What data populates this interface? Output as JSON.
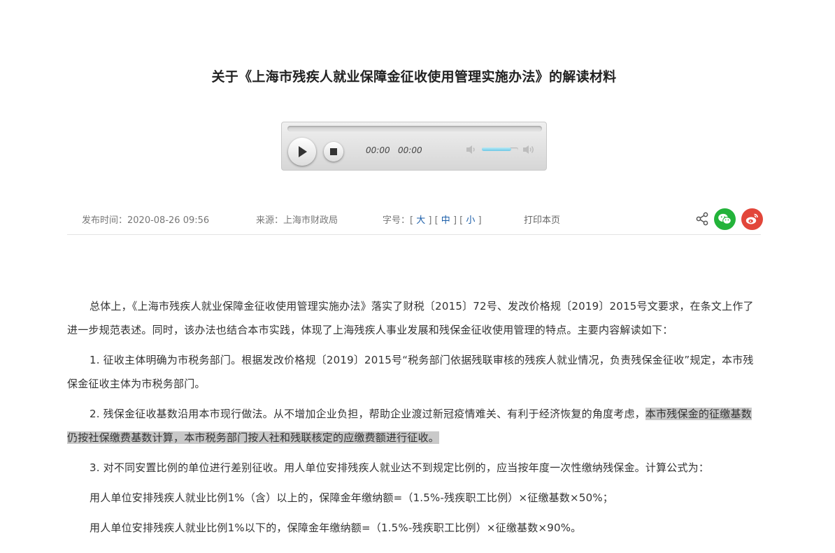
{
  "article": {
    "title": "关于《上海市残疾人就业保障金征收使用管理实施办法》的解读材料",
    "intro": "总体上，《上海市残疾人就业保障金征收使用管理实施办法》落实了财税〔2015〕72号、发改价格规〔2019〕2015号文要求，在条文上作了进一步规范表述。同时，该办法也结合本市实践，体现了上海残疾人事业发展和残保金征收使用管理的特点。主要内容解读如下：",
    "point1": "1. 征收主体明确为市税务部门。根据发改价格规〔2019〕2015号“税务部门依据残联审核的残疾人就业情况，负责残保金征收”规定，本市残保金征收主体为市税务部门。",
    "point2_plain": "2. 残保金征收基数沿用本市现行做法。从不增加企业负担，帮助企业渡过新冠疫情难关、有利于经济恢复的角度考虑，",
    "point2_highlight": "本市残保金的征缴基数仍按社保缴费基数计算，本市税务部门按人社和残联核定的应缴费额进行征收。",
    "point3": "3. 对不同安置比例的单位进行差别征收。用人单位安排残疾人就业达不到规定比例的，应当按年度一次性缴纳残保金。计算公式为：",
    "formula1": "用人单位安排残疾人就业比例1%（含）以上的，保障金年缴纳额=（1.5%-残疾职工比例）×征缴基数×50%；",
    "formula2": "用人单位安排残疾人就业比例1%以下的，保障金年缴纳额=（1.5%-残疾职工比例）×征缴基数×90%。"
  },
  "player": {
    "current_time": "00:00",
    "duration": "00:00",
    "progress": 0,
    "volume": 0.8,
    "play_icon": "play-icon",
    "stop_icon": "stop-icon",
    "volume_low_icon": "volume-low-icon",
    "volume_high_icon": "volume-high-icon"
  },
  "meta": {
    "publish_label": "发布时间：",
    "publish_date": "2020-08-26 09:56",
    "source_label": "来源：",
    "source": "上海市财政局",
    "font_label": "字号：",
    "font_large": "大",
    "font_medium": "中",
    "font_small": "小",
    "print": "打印本页"
  },
  "share": {
    "share_icon": "share-icon",
    "wechat_icon": "wechat-icon",
    "weibo_icon": "weibo-icon",
    "wechat_color": "#23b33a",
    "weibo_color": "#e2463a"
  },
  "colors": {
    "link": "#1b5ea9",
    "highlight": "#c9c9c9"
  }
}
